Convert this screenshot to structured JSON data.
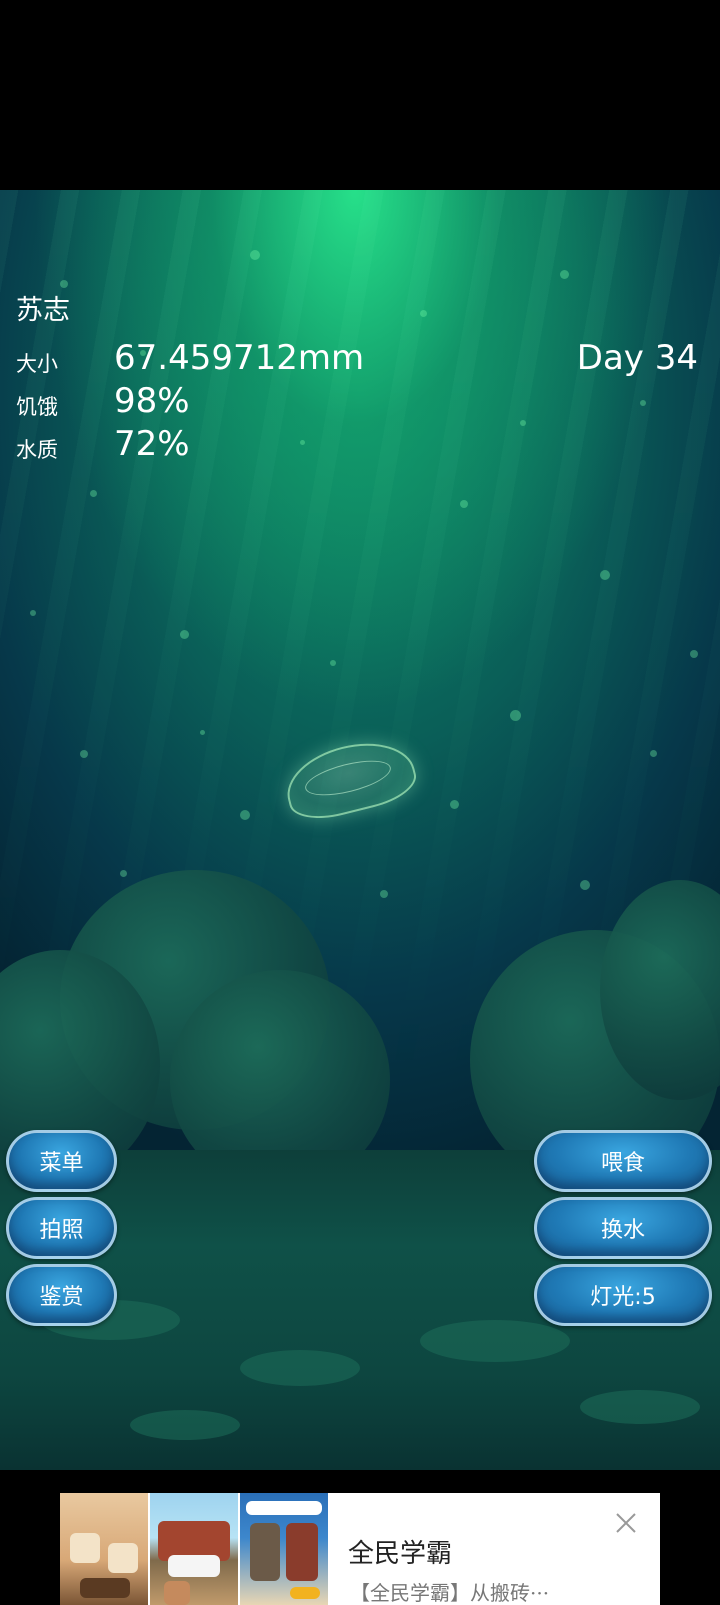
{
  "pet": {
    "name": "苏志",
    "day": "Day 34",
    "stats": [
      {
        "label": "大小",
        "value": "67.459712mm"
      },
      {
        "label": "饥饿",
        "value": "98%"
      },
      {
        "label": "水质",
        "value": "72%"
      }
    ]
  },
  "buttons": {
    "left": [
      "菜单",
      "拍照",
      "鉴赏"
    ],
    "right": [
      "喂食",
      "换水",
      "灯光:5"
    ]
  },
  "ad": {
    "title": "全民学霸",
    "subtitle": "【全民学霸】从搬砖···",
    "close_icon": "close-icon"
  },
  "colors": {
    "button_blue": "#1f79b5",
    "water_green": "#0f8a67"
  }
}
